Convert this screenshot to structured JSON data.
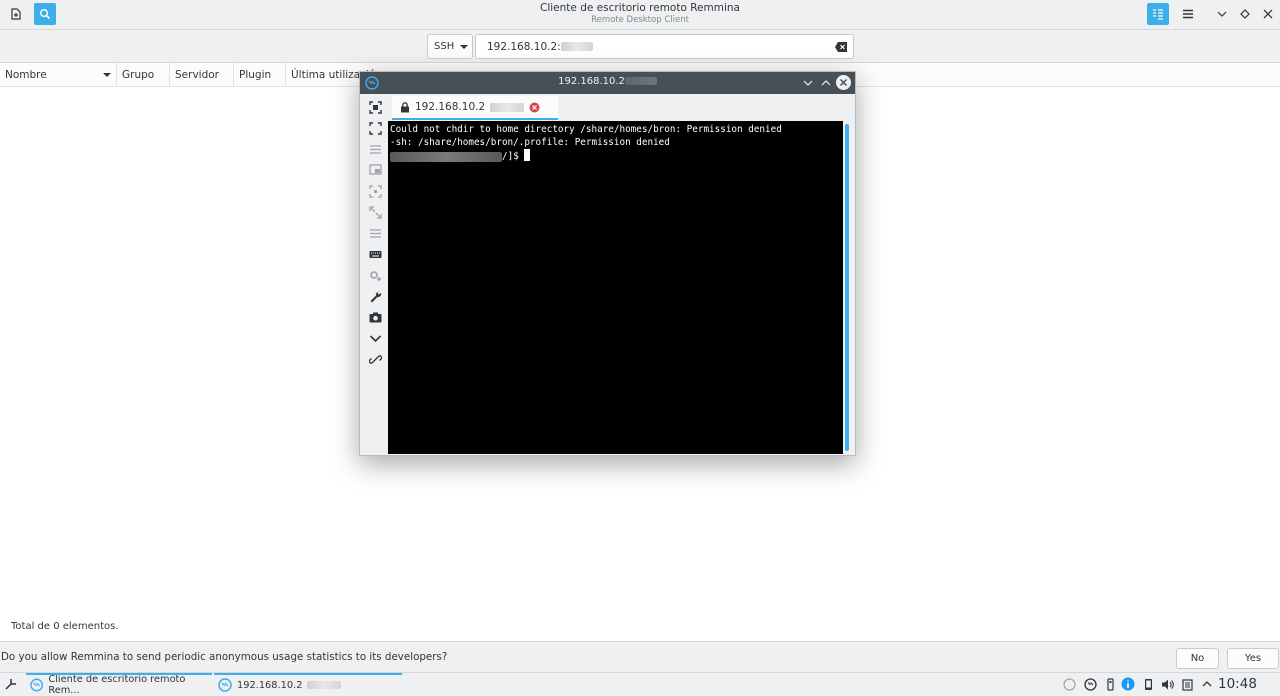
{
  "window": {
    "title": "Cliente de escritorio remoto Remmina",
    "subtitle": "Remote Desktop Client"
  },
  "toolbar": {
    "new_icon": "new-connection-icon",
    "search_icon": "search-icon",
    "view_icon": "list-view-icon",
    "menu_icon": "hamburger-menu-icon"
  },
  "search": {
    "protocol": "SSH",
    "address": "192.168.10.2:"
  },
  "columns": [
    "Nombre",
    "Grupo",
    "Servidor",
    "Plugin",
    "Última utilización"
  ],
  "status": {
    "text": "Total de 0 elementos."
  },
  "infobar": {
    "message": "Do you allow Remmina to send periodic anonymous usage statistics to its developers?",
    "no": "No",
    "yes": "Yes"
  },
  "session": {
    "title": "192.168.10.2",
    "tab_label": "192.168.10.2",
    "terminal": {
      "line1": "Could not chdir to home directory /share/homes/bron: Permission denied",
      "line2": "-sh: /share/homes/bron/.profile: Permission denied",
      "prompt_end": "/]$ "
    },
    "tools": [
      "fit-window-icon",
      "fullscreen-icon",
      "scaling-icon",
      "multi-monitor-icon",
      "dynamic-resolution-icon",
      "scaled-mode-icon",
      "preferences-list-icon",
      "keyboard-icon",
      "settings-icon",
      "tools-icon",
      "screenshot-icon",
      "minimize-icon",
      "disconnect-icon"
    ]
  },
  "taskbar": {
    "task1": "Cliente de escritorio remoto Rem...",
    "task2": "192.168.10.2",
    "clock": "10:48"
  },
  "colors": {
    "accent": "#3daee9",
    "titlebar_dark": "#475057",
    "terminal_bg": "#000000"
  }
}
